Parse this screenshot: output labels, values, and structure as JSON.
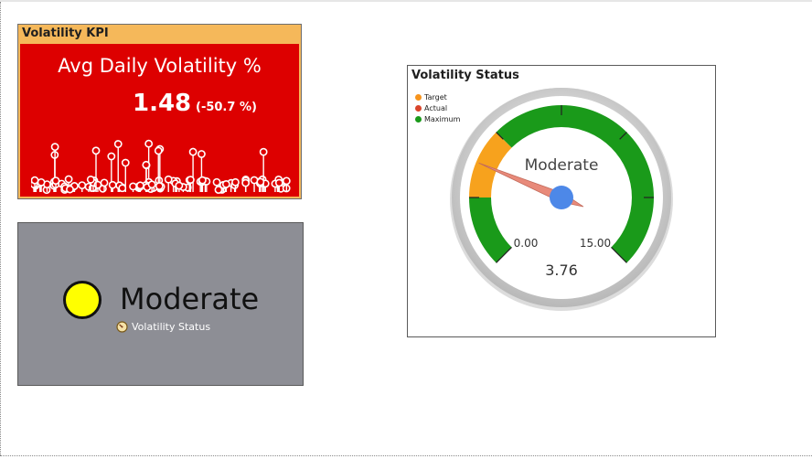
{
  "kpi": {
    "header": "Volatility KPI",
    "title": "Avg Daily Volatility %",
    "value": "1.48",
    "delta": "(-50.7 %)",
    "colors": {
      "header": "#f5b85a",
      "body": "#dd0000",
      "text": "#ffffff"
    }
  },
  "status": {
    "label": "Moderate",
    "subtitle": "Volatility Status",
    "indicator_color": "#ffff00",
    "icon": "gauge-icon"
  },
  "gauge": {
    "title": "Volatility Status",
    "legend": [
      {
        "label": "Target",
        "color": "#f7941d"
      },
      {
        "label": "Actual",
        "color": "#d9452b"
      },
      {
        "label": "Maximum",
        "color": "#1a9a1a"
      }
    ],
    "label": "Moderate",
    "min_label": "0.00",
    "max_label": "15.00",
    "value_label": "3.76",
    "min": 0,
    "max": 15,
    "value": 3.76,
    "bands": [
      {
        "from": 0,
        "to": 2.5,
        "color": "#1a9a1a"
      },
      {
        "from": 2.5,
        "to": 5.0,
        "color": "#f7a21d"
      },
      {
        "from": 5.0,
        "to": 15,
        "color": "#1a9a1a"
      }
    ],
    "needle_color": "#e88a7a",
    "hub_color": "#4d88e8"
  }
}
